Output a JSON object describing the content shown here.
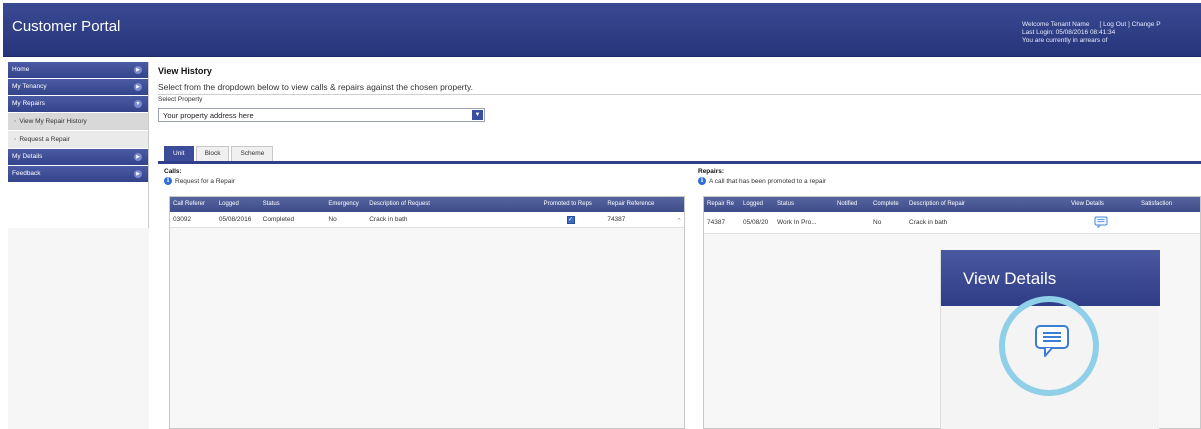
{
  "header": {
    "title": "Customer Portal",
    "welcome_label": "Welcome",
    "tenant_name": "Tenant Name",
    "last_login": "Last Login: 05/08/2016 08:41:34",
    "arrears": "You are currently in arrears of",
    "logout_link": "[ Log Out ]",
    "change_link": "Change P"
  },
  "sidebar": {
    "items": [
      {
        "label": "Home"
      },
      {
        "label": "My Tenancy"
      },
      {
        "label": "My Repairs"
      }
    ],
    "subitems": [
      {
        "label": "View My Repair History"
      },
      {
        "label": "Request a Repair"
      }
    ],
    "items_after": [
      {
        "label": "My Details"
      },
      {
        "label": "Feedback"
      }
    ]
  },
  "main": {
    "title": "View History",
    "instructions": "Select from the dropdown below to view calls & repairs against the chosen property.",
    "select_label": "Select Property",
    "select_value": "Your property address here",
    "tabs": [
      "Unit",
      "Block",
      "Scheme"
    ]
  },
  "calls": {
    "label": "Calls:",
    "note": "Request for a Repair",
    "columns": [
      "Call Referer",
      "Logged",
      "Status",
      "Emergency",
      "Description of Request",
      "Promoted to Reps",
      "Repair Reference"
    ],
    "rows": [
      {
        "ref": "03092",
        "logged": "05/08/2016",
        "status": "Completed",
        "emergency": "No",
        "description": "Crack in bath",
        "promoted": true,
        "repair_ref": "74387"
      }
    ]
  },
  "repairs": {
    "label": "Repairs:",
    "note": "A call that has been promoted to a repair",
    "columns": [
      "Repair Re",
      "Logged",
      "Status",
      "Notified",
      "Complete",
      "Description of Repair",
      "View Details",
      "Satisfaction"
    ],
    "rows": [
      {
        "ref": "74387",
        "logged": "05/08/20",
        "status": "Work In Pro...",
        "notified": "",
        "complete": "No",
        "description": "Crack in bath"
      }
    ]
  },
  "zoom": {
    "title": "View Details"
  },
  "colors": {
    "brand": "#2f3d86",
    "accent": "#8fd0e8",
    "info": "#2f6fd6"
  }
}
